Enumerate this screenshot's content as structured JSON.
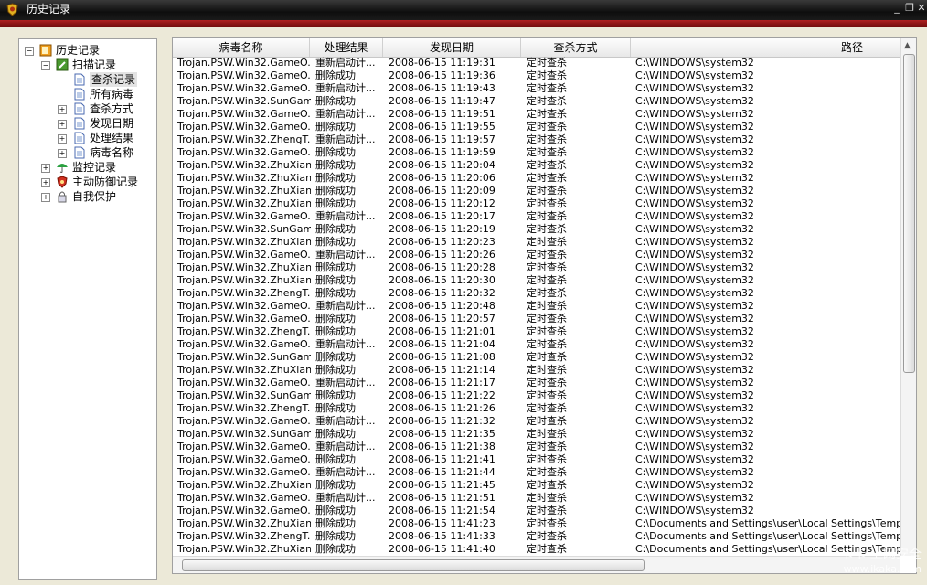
{
  "window": {
    "title": "历史记录",
    "buttons": {
      "minimize": "_",
      "restore": "❐",
      "close": "✕"
    }
  },
  "tree": [
    {
      "label": "历史记录",
      "icon": "orange-book-icon",
      "expander": "−"
    },
    {
      "label": "扫描记录",
      "icon": "green-scan-icon",
      "expander": "−"
    },
    {
      "label": "查杀记录",
      "icon": "document-icon",
      "expander": ""
    },
    {
      "label": "所有病毒",
      "icon": "document-icon",
      "expander": ""
    },
    {
      "label": "查杀方式",
      "icon": "document-icon",
      "expander": "+"
    },
    {
      "label": "发现日期",
      "icon": "document-icon",
      "expander": "+"
    },
    {
      "label": "处理结果",
      "icon": "document-icon",
      "expander": "+"
    },
    {
      "label": "病毒名称",
      "icon": "document-icon",
      "expander": "+"
    },
    {
      "label": "监控记录",
      "icon": "umbrella-icon",
      "expander": "+"
    },
    {
      "label": "主动防御记录",
      "icon": "shield-icon",
      "expander": "+"
    },
    {
      "label": "自我保护",
      "icon": "lock-icon",
      "expander": "+"
    }
  ],
  "columns": [
    "病毒名称",
    "处理结果",
    "发现日期",
    "查杀方式",
    "路径"
  ],
  "rows": [
    [
      "Trojan.PSW.Win32.GameO...",
      "重新启动计...",
      "2008-06-15 11:19:31",
      "定时查杀",
      "C:\\WINDOWS\\system32"
    ],
    [
      "Trojan.PSW.Win32.GameO...",
      "删除成功",
      "2008-06-15 11:19:36",
      "定时查杀",
      "C:\\WINDOWS\\system32"
    ],
    [
      "Trojan.PSW.Win32.GameO...",
      "重新启动计...",
      "2008-06-15 11:19:43",
      "定时查杀",
      "C:\\WINDOWS\\system32"
    ],
    [
      "Trojan.PSW.Win32.SunGam...",
      "删除成功",
      "2008-06-15 11:19:47",
      "定时查杀",
      "C:\\WINDOWS\\system32"
    ],
    [
      "Trojan.PSW.Win32.GameO...",
      "重新启动计...",
      "2008-06-15 11:19:51",
      "定时查杀",
      "C:\\WINDOWS\\system32"
    ],
    [
      "Trojan.PSW.Win32.GameO...",
      "删除成功",
      "2008-06-15 11:19:55",
      "定时查杀",
      "C:\\WINDOWS\\system32"
    ],
    [
      "Trojan.PSW.Win32.ZhengT...",
      "重新启动计...",
      "2008-06-15 11:19:57",
      "定时查杀",
      "C:\\WINDOWS\\system32"
    ],
    [
      "Trojan.PSW.Win32.GameO...",
      "删除成功",
      "2008-06-15 11:19:59",
      "定时查杀",
      "C:\\WINDOWS\\system32"
    ],
    [
      "Trojan.PSW.Win32.ZhuXian...",
      "删除成功",
      "2008-06-15 11:20:04",
      "定时查杀",
      "C:\\WINDOWS\\system32"
    ],
    [
      "Trojan.PSW.Win32.ZhuXian...",
      "删除成功",
      "2008-06-15 11:20:06",
      "定时查杀",
      "C:\\WINDOWS\\system32"
    ],
    [
      "Trojan.PSW.Win32.ZhuXian...",
      "删除成功",
      "2008-06-15 11:20:09",
      "定时查杀",
      "C:\\WINDOWS\\system32"
    ],
    [
      "Trojan.PSW.Win32.ZhuXian...",
      "删除成功",
      "2008-06-15 11:20:12",
      "定时查杀",
      "C:\\WINDOWS\\system32"
    ],
    [
      "Trojan.PSW.Win32.GameO...",
      "重新启动计...",
      "2008-06-15 11:20:17",
      "定时查杀",
      "C:\\WINDOWS\\system32"
    ],
    [
      "Trojan.PSW.Win32.SunGam...",
      "删除成功",
      "2008-06-15 11:20:19",
      "定时查杀",
      "C:\\WINDOWS\\system32"
    ],
    [
      "Trojan.PSW.Win32.ZhuXian...",
      "删除成功",
      "2008-06-15 11:20:23",
      "定时查杀",
      "C:\\WINDOWS\\system32"
    ],
    [
      "Trojan.PSW.Win32.GameO...",
      "重新启动计...",
      "2008-06-15 11:20:26",
      "定时查杀",
      "C:\\WINDOWS\\system32"
    ],
    [
      "Trojan.PSW.Win32.ZhuXian...",
      "删除成功",
      "2008-06-15 11:20:28",
      "定时查杀",
      "C:\\WINDOWS\\system32"
    ],
    [
      "Trojan.PSW.Win32.ZhuXian...",
      "删除成功",
      "2008-06-15 11:20:30",
      "定时查杀",
      "C:\\WINDOWS\\system32"
    ],
    [
      "Trojan.PSW.Win32.ZhengT...",
      "删除成功",
      "2008-06-15 11:20:32",
      "定时查杀",
      "C:\\WINDOWS\\system32"
    ],
    [
      "Trojan.PSW.Win32.GameO...",
      "重新启动计...",
      "2008-06-15 11:20:48",
      "定时查杀",
      "C:\\WINDOWS\\system32"
    ],
    [
      "Trojan.PSW.Win32.GameO...",
      "删除成功",
      "2008-06-15 11:20:57",
      "定时查杀",
      "C:\\WINDOWS\\system32"
    ],
    [
      "Trojan.PSW.Win32.ZhengT...",
      "删除成功",
      "2008-06-15 11:21:01",
      "定时查杀",
      "C:\\WINDOWS\\system32"
    ],
    [
      "Trojan.PSW.Win32.GameO...",
      "重新启动计...",
      "2008-06-15 11:21:04",
      "定时查杀",
      "C:\\WINDOWS\\system32"
    ],
    [
      "Trojan.PSW.Win32.SunGam...",
      "删除成功",
      "2008-06-15 11:21:08",
      "定时查杀",
      "C:\\WINDOWS\\system32"
    ],
    [
      "Trojan.PSW.Win32.ZhuXian...",
      "删除成功",
      "2008-06-15 11:21:14",
      "定时查杀",
      "C:\\WINDOWS\\system32"
    ],
    [
      "Trojan.PSW.Win32.GameO...",
      "重新启动计...",
      "2008-06-15 11:21:17",
      "定时查杀",
      "C:\\WINDOWS\\system32"
    ],
    [
      "Trojan.PSW.Win32.SunGam...",
      "删除成功",
      "2008-06-15 11:21:22",
      "定时查杀",
      "C:\\WINDOWS\\system32"
    ],
    [
      "Trojan.PSW.Win32.ZhengT...",
      "删除成功",
      "2008-06-15 11:21:26",
      "定时查杀",
      "C:\\WINDOWS\\system32"
    ],
    [
      "Trojan.PSW.Win32.GameO...",
      "重新启动计...",
      "2008-06-15 11:21:32",
      "定时查杀",
      "C:\\WINDOWS\\system32"
    ],
    [
      "Trojan.PSW.Win32.SunGam...",
      "删除成功",
      "2008-06-15 11:21:35",
      "定时查杀",
      "C:\\WINDOWS\\system32"
    ],
    [
      "Trojan.PSW.Win32.GameO...",
      "重新启动计...",
      "2008-06-15 11:21:38",
      "定时查杀",
      "C:\\WINDOWS\\system32"
    ],
    [
      "Trojan.PSW.Win32.GameO...",
      "删除成功",
      "2008-06-15 11:21:41",
      "定时查杀",
      "C:\\WINDOWS\\system32"
    ],
    [
      "Trojan.PSW.Win32.GameO...",
      "重新启动计...",
      "2008-06-15 11:21:44",
      "定时查杀",
      "C:\\WINDOWS\\system32"
    ],
    [
      "Trojan.PSW.Win32.ZhuXian...",
      "删除成功",
      "2008-06-15 11:21:45",
      "定时查杀",
      "C:\\WINDOWS\\system32"
    ],
    [
      "Trojan.PSW.Win32.GameO...",
      "重新启动计...",
      "2008-06-15 11:21:51",
      "定时查杀",
      "C:\\WINDOWS\\system32"
    ],
    [
      "Trojan.PSW.Win32.GameO...",
      "删除成功",
      "2008-06-15 11:21:54",
      "定时查杀",
      "C:\\WINDOWS\\system32"
    ],
    [
      "Trojan.PSW.Win32.ZhuXian...",
      "删除成功",
      "2008-06-15 11:41:23",
      "定时查杀",
      "C:\\Documents and Settings\\user\\Local Settings\\Temporary I"
    ],
    [
      "Trojan.PSW.Win32.ZhengT...",
      "删除成功",
      "2008-06-15 11:41:33",
      "定时查杀",
      "C:\\Documents and Settings\\user\\Local Settings\\Temporary I"
    ],
    [
      "Trojan.PSW.Win32.ZhuXian...",
      "删除成功",
      "2008-06-15 11:41:40",
      "定时查杀",
      "C:\\Documents and Settings\\user\\Local Settings\\Temporary I"
    ]
  ],
  "watermark": {
    "main": "卡卡 上网安全",
    "url": "www.ikaka.com"
  }
}
